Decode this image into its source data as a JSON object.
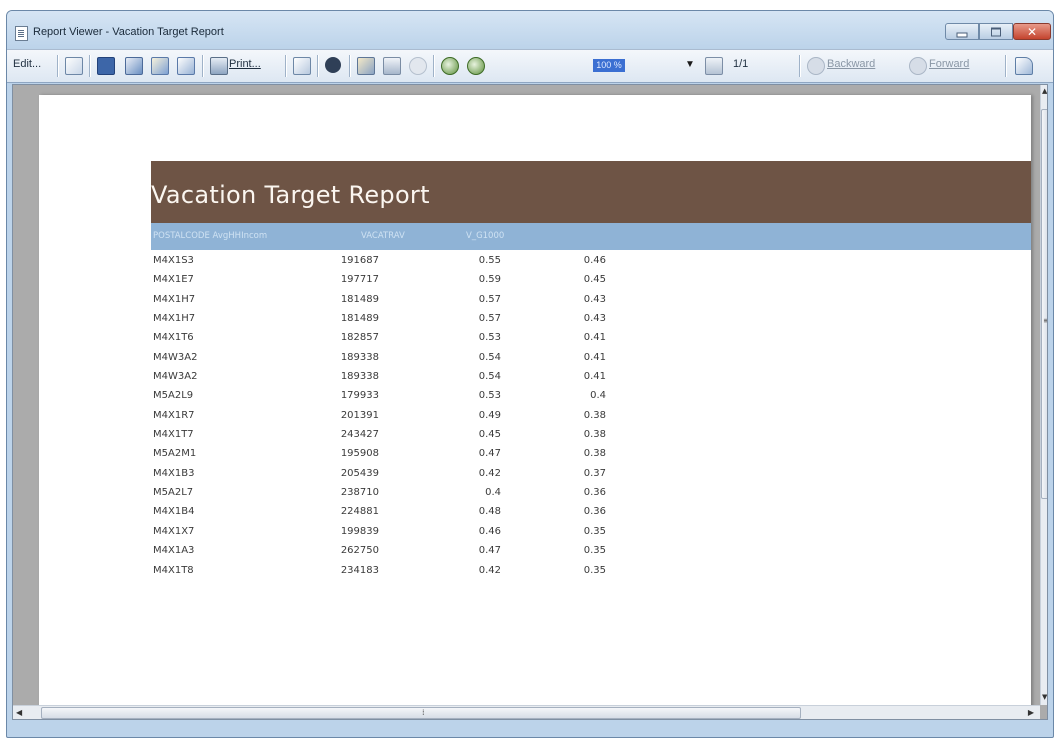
{
  "window": {
    "title": "Report Viewer - Vacation Target Report"
  },
  "toolbar": {
    "edit_label": "Edit...",
    "print_label": "Print...",
    "zoom_value": "100 %",
    "page_indicator": "1/1",
    "backward_label": "Backward",
    "forward_label": "Forward"
  },
  "icons": {
    "close": "✕",
    "dropdown": "▼",
    "scroll_up": "▲",
    "scroll_down": "▼",
    "scroll_left": "◀",
    "scroll_right": "▶",
    "grip_v": "≡",
    "grip_h": "⁞"
  },
  "colors": {
    "header_band": "#6e5445",
    "column_band": "#8fb3d6"
  },
  "report": {
    "title": "Vacation Target Report",
    "columns": [
      "POSTALCODE AvgHHIncom",
      "VACATRAV",
      "V_G1000"
    ],
    "rows": [
      [
        "M4X1S3",
        "191687",
        "0.55",
        "0.46"
      ],
      [
        "M4X1E7",
        "197717",
        "0.59",
        "0.45"
      ],
      [
        "M4X1H7",
        "181489",
        "0.57",
        "0.43"
      ],
      [
        "M4X1H7",
        "181489",
        "0.57",
        "0.43"
      ],
      [
        "M4X1T6",
        "182857",
        "0.53",
        "0.41"
      ],
      [
        "M4W3A2",
        "189338",
        "0.54",
        "0.41"
      ],
      [
        "M4W3A2",
        "189338",
        "0.54",
        "0.41"
      ],
      [
        "M5A2L9",
        "179933",
        "0.53",
        "0.4"
      ],
      [
        "M4X1R7",
        "201391",
        "0.49",
        "0.38"
      ],
      [
        "M4X1T7",
        "243427",
        "0.45",
        "0.38"
      ],
      [
        "M5A2M1",
        "195908",
        "0.47",
        "0.38"
      ],
      [
        "M4X1B3",
        "205439",
        "0.42",
        "0.37"
      ],
      [
        "M5A2L7",
        "238710",
        "0.4",
        "0.36"
      ],
      [
        "M4X1B4",
        "224881",
        "0.48",
        "0.36"
      ],
      [
        "M4X1X7",
        "199839",
        "0.46",
        "0.35"
      ],
      [
        "M4X1A3",
        "262750",
        "0.47",
        "0.35"
      ],
      [
        "M4X1T8",
        "234183",
        "0.42",
        "0.35"
      ]
    ]
  }
}
